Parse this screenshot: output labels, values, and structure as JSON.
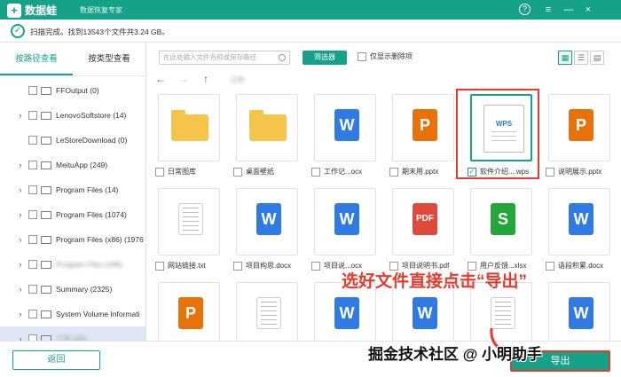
{
  "app": {
    "name": "数据蛙",
    "subtitle": "数据恢复专家",
    "help": "?",
    "menu": "≡",
    "minimize": "—",
    "close": "×"
  },
  "status": {
    "text": "扫描完成。找到13543个文件共3.24 GB。"
  },
  "tabs": [
    {
      "label": "按路径查看",
      "active": true
    },
    {
      "label": "按类型查看",
      "active": false
    }
  ],
  "tree": [
    {
      "label": "FFOutput (0)",
      "expandable": false
    },
    {
      "label": "LenovoSoftstore (14)",
      "expandable": true
    },
    {
      "label": "LeStoreDownload (0)",
      "expandable": false
    },
    {
      "label": "MeituApp (249)",
      "expandable": true
    },
    {
      "label": "Program Files (14)",
      "expandable": true
    },
    {
      "label": "Program Files (1074)",
      "expandable": true
    },
    {
      "label": "Program Files (x86) (1976",
      "expandable": true
    },
    {
      "label": "Program Files (x86)",
      "expandable": true,
      "blurred": true
    },
    {
      "label": "Summary (2325)",
      "expandable": true
    },
    {
      "label": "System Volume Informati",
      "expandable": true
    },
    {
      "label": "工作 (25)",
      "expandable": true,
      "blurred": true
    }
  ],
  "toolbar": {
    "search_placeholder": "在此处输入文件名称或保存路径",
    "filter_label": "筛选器",
    "only_deleted_label": "仅显示删除项",
    "view_grid": "▦",
    "view_list": "☰",
    "view_detail": "▤"
  },
  "nav": {
    "back": "←",
    "forward": "→",
    "up": "↑",
    "path": "工作"
  },
  "files": [
    {
      "name": "日常图库",
      "icon": "folder-icon"
    },
    {
      "name": "桌面壁纸",
      "icon": "folder-icon"
    },
    {
      "name": "工作记...ocx",
      "icon": "word-icon",
      "glyph": "W"
    },
    {
      "name": "期末用.pptx",
      "icon": "ppt-icon",
      "glyph": "P"
    },
    {
      "name": "软件介绍....wps",
      "icon": "wps-icon",
      "glyph": "WPS",
      "checked": true
    },
    {
      "name": "说明展示.pptx",
      "icon": "ppt-icon",
      "glyph": "P"
    },
    {
      "name": "网站链接.txt",
      "icon": "txt-icon"
    },
    {
      "name": "项目构思.docx",
      "icon": "word-icon",
      "glyph": "W"
    },
    {
      "name": "项目说...ocx",
      "icon": "word-icon",
      "glyph": "W"
    },
    {
      "name": "项目说明书.pdf",
      "icon": "pdf-icon",
      "glyph": "PDF"
    },
    {
      "name": "用户反馈...xlsx",
      "icon": "excel-icon",
      "glyph": "S"
    },
    {
      "name": "语段积累.docx",
      "icon": "word-icon",
      "glyph": "W"
    },
    {
      "name": "",
      "icon": "ppt-icon",
      "glyph": "P"
    },
    {
      "name": "",
      "icon": "txt-icon"
    },
    {
      "name": "",
      "icon": "word-icon",
      "glyph": "W"
    },
    {
      "name": "",
      "icon": "word-icon",
      "glyph": "W"
    },
    {
      "name": "",
      "icon": "txt-icon"
    },
    {
      "name": "",
      "icon": "word-icon",
      "glyph": "W"
    }
  ],
  "annotation": "选好文件直接点击“导出”",
  "bottom": {
    "back_label": "返回",
    "export_label": "导出"
  },
  "watermark": "掘金技术社区 @ 小明助手",
  "colors": {
    "primary": "#16a288",
    "highlight": "#e53a2c"
  }
}
